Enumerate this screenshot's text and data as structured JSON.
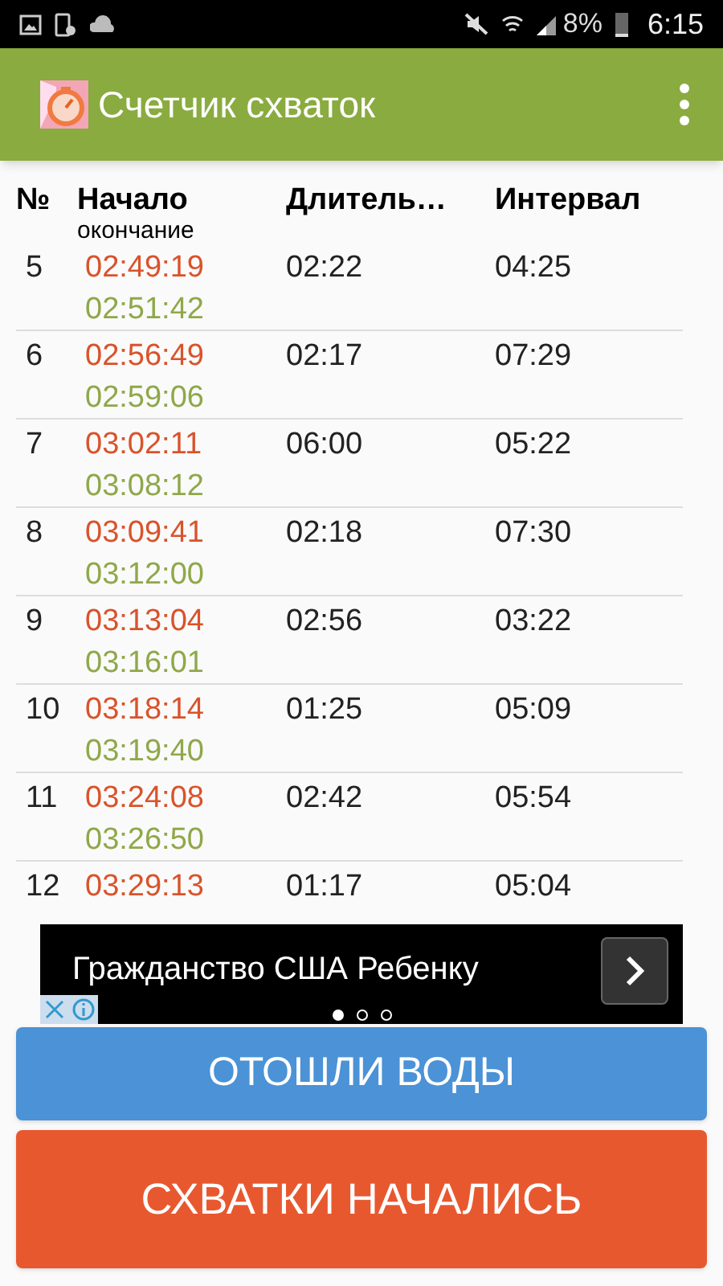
{
  "status_bar": {
    "battery": "8%",
    "time": "6:15"
  },
  "app_bar": {
    "title": "Счетчик схваток"
  },
  "table": {
    "columns": [
      "№",
      "Начало",
      "Длитель…",
      "Интервал"
    ],
    "subheading": "окончание",
    "rows": [
      {
        "number": "5",
        "start": "02:49:19",
        "end": "02:51:42",
        "duration": "02:22",
        "interval": "04:25"
      },
      {
        "number": "6",
        "start": "02:56:49",
        "end": "02:59:06",
        "duration": "02:17",
        "interval": "07:29"
      },
      {
        "number": "7",
        "start": "03:02:11",
        "end": "03:08:12",
        "duration": "06:00",
        "interval": "05:22"
      },
      {
        "number": "8",
        "start": "03:09:41",
        "end": "03:12:00",
        "duration": "02:18",
        "interval": "07:30"
      },
      {
        "number": "9",
        "start": "03:13:04",
        "end": "03:16:01",
        "duration": "02:56",
        "interval": "03:22"
      },
      {
        "number": "10",
        "start": "03:18:14",
        "end": "03:19:40",
        "duration": "01:25",
        "interval": "05:09"
      },
      {
        "number": "11",
        "start": "03:24:08",
        "end": "03:26:50",
        "duration": "02:42",
        "interval": "05:54"
      },
      {
        "number": "12",
        "start": "03:29:13",
        "duration": "01:17",
        "interval": "05:04"
      }
    ]
  },
  "ad": {
    "text": "Гражданство США Ребенку",
    "pages": [
      {
        "selected": true
      },
      {
        "selected": false
      },
      {
        "selected": false
      }
    ]
  },
  "buttons": [
    {
      "kind": "secondary",
      "label": "ОТОШЛИ ВОДЫ"
    },
    {
      "kind": "primary",
      "label": "СХВАТКИ НАЧАЛИСЬ"
    }
  ]
}
